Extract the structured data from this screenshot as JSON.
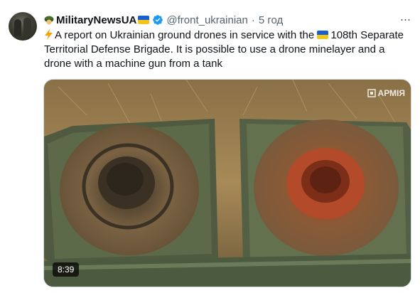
{
  "tweet": {
    "author_name": "MilitaryNewsUA",
    "handle": "@front_ukrainian",
    "separator": "·",
    "time": "5 год",
    "more_label": "···",
    "text_part1": "A report on Ukrainian ground drones in service with the",
    "text_part2": "108th Separate Territorial Defense Brigade. It is possible to use a drone minelayer and a drone with a machine gun from a tank"
  },
  "media": {
    "watermark": "АРМІЯ",
    "duration": "8:39"
  },
  "colors": {
    "text_primary": "#0f1419",
    "text_secondary": "#536471",
    "verified_blue": "#1d9bf0",
    "flag_blue": "#1a5fd0",
    "flag_yellow": "#f5c518"
  },
  "icons": [
    "avatar",
    "soldier-emoji-icon",
    "ukraine-flag-icon",
    "verified-badge-icon",
    "more-options-icon",
    "lightning-emoji-icon",
    "army-tv-logo-icon"
  ]
}
